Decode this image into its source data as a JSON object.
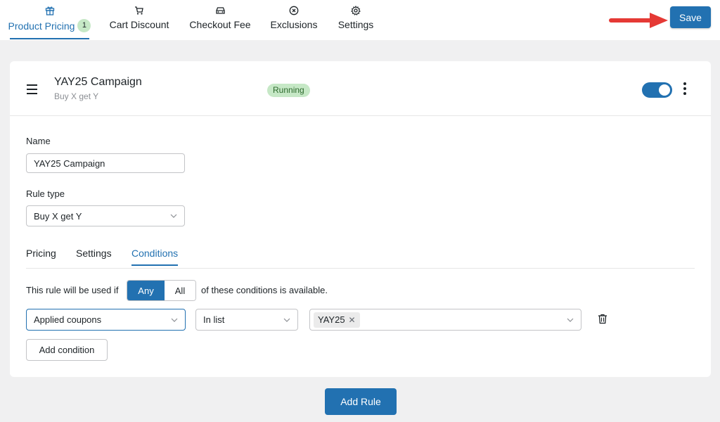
{
  "tabs": [
    {
      "label": "Product Pricing",
      "icon": "gift-icon",
      "badge": "1",
      "active": true
    },
    {
      "label": "Cart Discount",
      "icon": "cart-icon"
    },
    {
      "label": "Checkout Fee",
      "icon": "car-icon"
    },
    {
      "label": "Exclusions",
      "icon": "x-circle-icon"
    },
    {
      "label": "Settings",
      "icon": "gear-icon"
    }
  ],
  "save_label": "Save",
  "campaign": {
    "title": "YAY25 Campaign",
    "subtitle": "Buy X get Y",
    "status": "Running",
    "enabled": true
  },
  "form": {
    "name_label": "Name",
    "name_value": "YAY25 Campaign",
    "rule_type_label": "Rule type",
    "rule_type_value": "Buy X get Y"
  },
  "subtabs": [
    {
      "label": "Pricing"
    },
    {
      "label": "Settings"
    },
    {
      "label": "Conditions",
      "active": true
    }
  ],
  "conditions": {
    "intro": "This rule will be used if",
    "match_any": "Any",
    "match_all": "All",
    "outro": "of these conditions is available.",
    "type": "Applied coupons",
    "operator": "In list",
    "tags": [
      "YAY25"
    ],
    "add_condition_label": "Add condition"
  },
  "add_rule_label": "Add Rule",
  "colors": {
    "accent": "#2271b1",
    "running_bg": "#c6e8c6",
    "annotation_arrow": "#e53935"
  }
}
